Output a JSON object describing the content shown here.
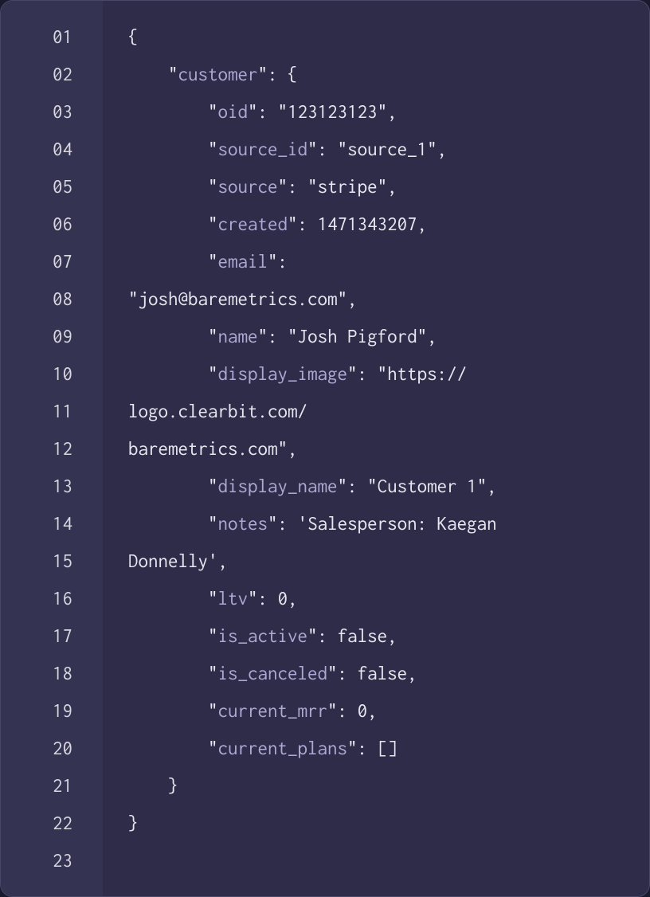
{
  "code_block": {
    "lines": [
      {
        "num": "01",
        "segments": [
          {
            "cls": "tok-punct",
            "text": "{"
          }
        ],
        "indent": 0
      },
      {
        "num": "02",
        "segments": [
          {
            "cls": "tok-punct",
            "text": "\""
          },
          {
            "cls": "tok-key",
            "text": "customer"
          },
          {
            "cls": "tok-punct",
            "text": "\": {"
          }
        ],
        "indent": 2
      },
      {
        "num": "03",
        "segments": [
          {
            "cls": "tok-punct",
            "text": "\""
          },
          {
            "cls": "tok-key",
            "text": "oid"
          },
          {
            "cls": "tok-punct",
            "text": "\": \""
          },
          {
            "cls": "tok-string",
            "text": "123123123"
          },
          {
            "cls": "tok-punct",
            "text": "\","
          }
        ],
        "indent": 4
      },
      {
        "num": "04",
        "segments": [
          {
            "cls": "tok-punct",
            "text": "\""
          },
          {
            "cls": "tok-key",
            "text": "source_id"
          },
          {
            "cls": "tok-punct",
            "text": "\": \""
          },
          {
            "cls": "tok-string",
            "text": "source_1"
          },
          {
            "cls": "tok-punct",
            "text": "\","
          }
        ],
        "indent": 4
      },
      {
        "num": "05",
        "segments": [
          {
            "cls": "tok-punct",
            "text": "\""
          },
          {
            "cls": "tok-key",
            "text": "source"
          },
          {
            "cls": "tok-punct",
            "text": "\": \""
          },
          {
            "cls": "tok-string",
            "text": "stripe"
          },
          {
            "cls": "tok-punct",
            "text": "\","
          }
        ],
        "indent": 4
      },
      {
        "num": "06",
        "segments": [
          {
            "cls": "tok-punct",
            "text": "\""
          },
          {
            "cls": "tok-key",
            "text": "created"
          },
          {
            "cls": "tok-punct",
            "text": "\": "
          },
          {
            "cls": "tok-plain",
            "text": "1471343207,"
          }
        ],
        "indent": 4
      },
      {
        "num": "07",
        "segments": [
          {
            "cls": "tok-punct",
            "text": "\""
          },
          {
            "cls": "tok-key",
            "text": "email"
          },
          {
            "cls": "tok-punct",
            "text": "\":"
          }
        ],
        "indent": 4
      },
      {
        "num": "08",
        "segments": [
          {
            "cls": "tok-punct",
            "text": "\""
          },
          {
            "cls": "tok-string",
            "text": "josh@baremetrics.com"
          },
          {
            "cls": "tok-punct",
            "text": "\","
          }
        ],
        "indent": 0
      },
      {
        "num": "09",
        "segments": [
          {
            "cls": "tok-punct",
            "text": "\""
          },
          {
            "cls": "tok-key",
            "text": "name"
          },
          {
            "cls": "tok-punct",
            "text": "\": \""
          },
          {
            "cls": "tok-string",
            "text": "Josh Pigford"
          },
          {
            "cls": "tok-punct",
            "text": "\","
          }
        ],
        "indent": 4
      },
      {
        "num": "10",
        "segments": [
          {
            "cls": "tok-punct",
            "text": "\""
          },
          {
            "cls": "tok-key",
            "text": "display_image"
          },
          {
            "cls": "tok-punct",
            "text": "\": \""
          },
          {
            "cls": "tok-string",
            "text": "https://"
          }
        ],
        "indent": 4
      },
      {
        "num": "11",
        "segments": [
          {
            "cls": "tok-string",
            "text": "logo.clearbit.com/"
          }
        ],
        "indent": 0
      },
      {
        "num": "12",
        "segments": [
          {
            "cls": "tok-string",
            "text": "baremetrics.com"
          },
          {
            "cls": "tok-punct",
            "text": "\","
          }
        ],
        "indent": 0
      },
      {
        "num": "13",
        "segments": [
          {
            "cls": "tok-punct",
            "text": "\""
          },
          {
            "cls": "tok-key",
            "text": "display_name"
          },
          {
            "cls": "tok-punct",
            "text": "\": \""
          },
          {
            "cls": "tok-string",
            "text": "Customer 1"
          },
          {
            "cls": "tok-punct",
            "text": "\","
          }
        ],
        "indent": 4
      },
      {
        "num": "14",
        "segments": [
          {
            "cls": "tok-punct",
            "text": "\""
          },
          {
            "cls": "tok-key",
            "text": "notes"
          },
          {
            "cls": "tok-punct",
            "text": "\": '"
          },
          {
            "cls": "tok-string",
            "text": "Salesperson: Kaegan"
          }
        ],
        "indent": 4
      },
      {
        "num": "15",
        "segments": [
          {
            "cls": "tok-string",
            "text": "Donnelly"
          },
          {
            "cls": "tok-punct",
            "text": "',"
          }
        ],
        "indent": 0
      },
      {
        "num": "16",
        "segments": [
          {
            "cls": "tok-punct",
            "text": "\""
          },
          {
            "cls": "tok-key",
            "text": "ltv"
          },
          {
            "cls": "tok-punct",
            "text": "\": "
          },
          {
            "cls": "tok-plain",
            "text": "0,"
          }
        ],
        "indent": 4
      },
      {
        "num": "17",
        "segments": [
          {
            "cls": "tok-punct",
            "text": "\""
          },
          {
            "cls": "tok-key",
            "text": "is_active"
          },
          {
            "cls": "tok-punct",
            "text": "\": "
          },
          {
            "cls": "tok-plain",
            "text": "false,"
          }
        ],
        "indent": 4
      },
      {
        "num": "18",
        "segments": [
          {
            "cls": "tok-punct",
            "text": "\""
          },
          {
            "cls": "tok-key",
            "text": "is_canceled"
          },
          {
            "cls": "tok-punct",
            "text": "\": "
          },
          {
            "cls": "tok-plain",
            "text": "false,"
          }
        ],
        "indent": 4
      },
      {
        "num": "19",
        "segments": [
          {
            "cls": "tok-punct",
            "text": "\""
          },
          {
            "cls": "tok-key",
            "text": "current_mrr"
          },
          {
            "cls": "tok-punct",
            "text": "\": "
          },
          {
            "cls": "tok-plain",
            "text": "0,"
          }
        ],
        "indent": 4
      },
      {
        "num": "20",
        "segments": [
          {
            "cls": "tok-punct",
            "text": "\""
          },
          {
            "cls": "tok-key",
            "text": "current_plans"
          },
          {
            "cls": "tok-punct",
            "text": "\": []"
          }
        ],
        "indent": 4
      },
      {
        "num": "21",
        "segments": [
          {
            "cls": "tok-punct",
            "text": "}"
          }
        ],
        "indent": 2
      },
      {
        "num": "22",
        "segments": [
          {
            "cls": "tok-punct",
            "text": "}"
          }
        ],
        "indent": 0
      },
      {
        "num": "23",
        "segments": [],
        "indent": 0
      }
    ]
  }
}
